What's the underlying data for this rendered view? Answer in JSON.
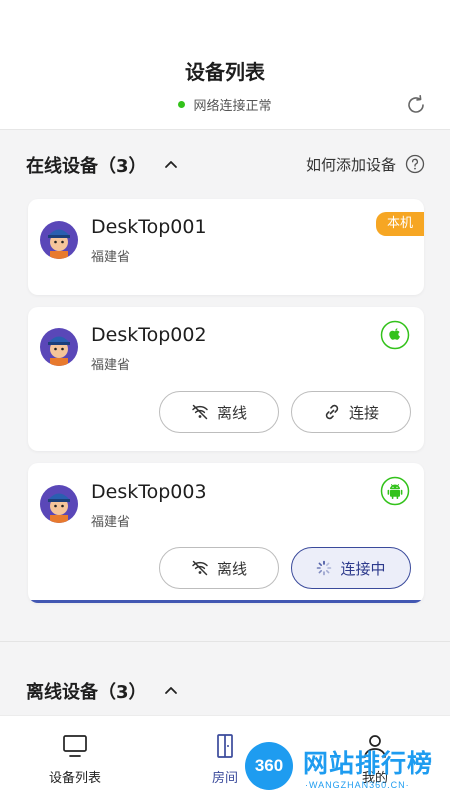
{
  "header": {
    "title": "设备列表",
    "status_text": "网络连接正常",
    "status_color": "#33c21b"
  },
  "online_section": {
    "title": "在线设备（3）",
    "help_text": "如何添加设备"
  },
  "devices": [
    {
      "name": "DeskTop001",
      "location": "福建省",
      "badge": "本机"
    },
    {
      "name": "DeskTop002",
      "location": "福建省",
      "os_icon": "apple-icon",
      "buttons": [
        "离线",
        "连接"
      ]
    },
    {
      "name": "DeskTop003",
      "location": "福建省",
      "os_icon": "android-icon",
      "buttons": [
        "离线",
        "连接中"
      ]
    }
  ],
  "offline_section": {
    "title": "离线设备（3）"
  },
  "tabbar": {
    "items": [
      {
        "label": "设备列表",
        "icon": "monitor-icon"
      },
      {
        "label": "房间",
        "icon": "door-icon",
        "active": true
      },
      {
        "label": "我的",
        "icon": "person-icon"
      }
    ]
  },
  "watermark": {
    "logo": "360",
    "text": "网站排行榜",
    "sub": "·WANGZHAN360.CN·"
  },
  "colors": {
    "accent": "#3a4a9b",
    "badge": "#f6a623",
    "os_green": "#33c21b"
  }
}
